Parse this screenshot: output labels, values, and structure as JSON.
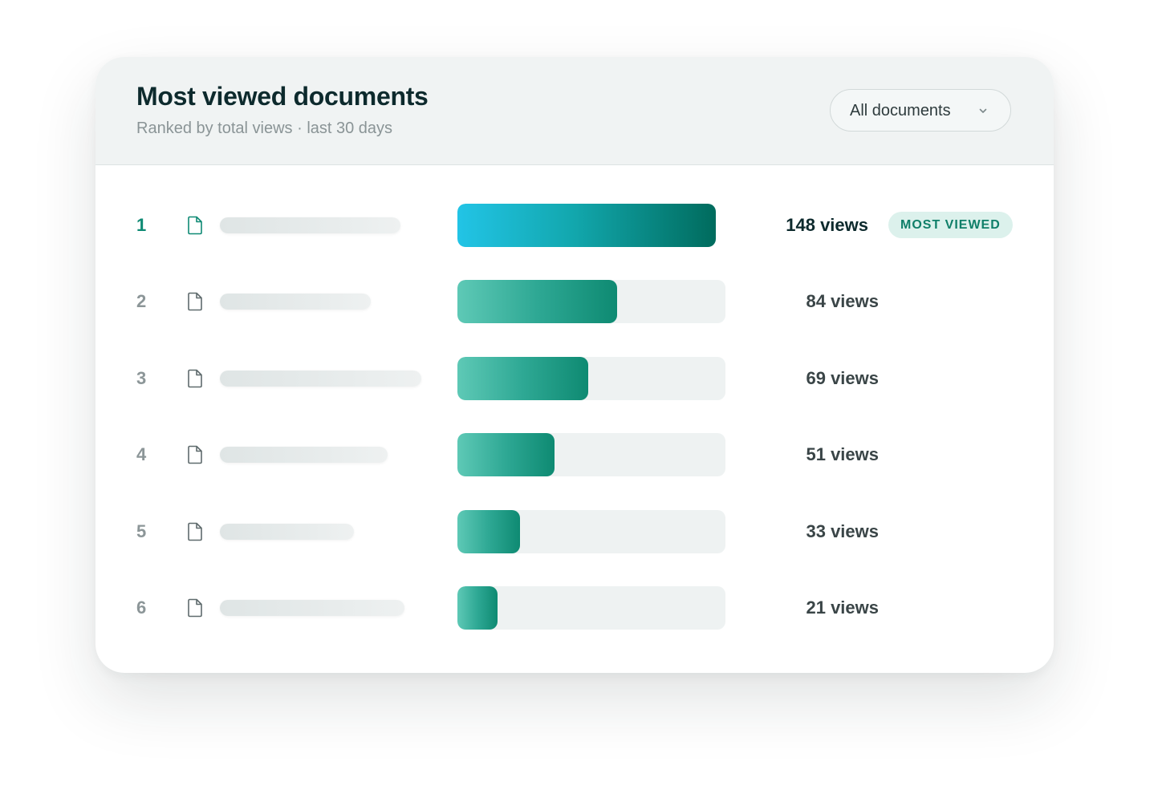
{
  "header": {
    "title": "Most viewed documents",
    "subtitle": "Ranked by total views · last 30 days",
    "filter_label": "All documents",
    "filter_icon": "chevron-down-icon"
  },
  "colors": {
    "accent": "#0f8a74",
    "top_bar_start": "#22c4e6",
    "top_bar_end": "#006b5d",
    "bar_start": "#5ec9b6",
    "bar_end": "#0e8a72",
    "badge_bg": "#dcf1ec"
  },
  "chart_data": {
    "type": "bar",
    "orientation": "horizontal",
    "categories": [
      "1",
      "2",
      "3",
      "4",
      "5",
      "6"
    ],
    "values": [
      148,
      84,
      69,
      51,
      33,
      21
    ],
    "value_labels": [
      "148 views",
      "84 views",
      "69 views",
      "51 views",
      "33 views",
      "21 views"
    ],
    "xlim": [
      0,
      148
    ],
    "highlight": {
      "index": 0,
      "badge": "MOST VIEWED"
    },
    "row_icon": "document-icon"
  }
}
